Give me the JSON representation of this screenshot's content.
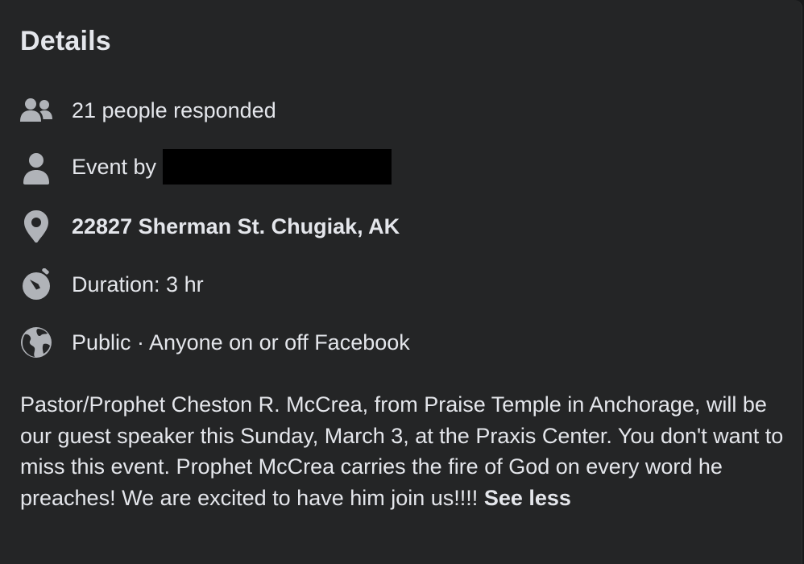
{
  "details": {
    "title": "Details",
    "responded": "21 people responded",
    "event_by_label": "Event by",
    "address": "22827 Sherman St. Chugiak, AK",
    "duration": "Duration: 3 hr",
    "privacy": "Public · Anyone on or off Facebook"
  },
  "description": {
    "text": "Pastor/Prophet Cheston R. McCrea, from Praise Temple in Anchorage, will be our guest speaker this Sunday, March 3, at the Praxis Center. You don't want to miss this event. Prophet McCrea carries the fire of God on every word he preaches! We are excited to have him join us!!!!",
    "see_less": "See less"
  },
  "icons": {
    "responded": "people-icon",
    "host": "person-icon",
    "location": "map-pin-icon",
    "duration": "stopwatch-icon",
    "privacy": "globe-icon"
  },
  "colors": {
    "background": "#242526",
    "text": "#e4e6eb",
    "icon": "#b0b3b8",
    "redaction": "#000000"
  }
}
